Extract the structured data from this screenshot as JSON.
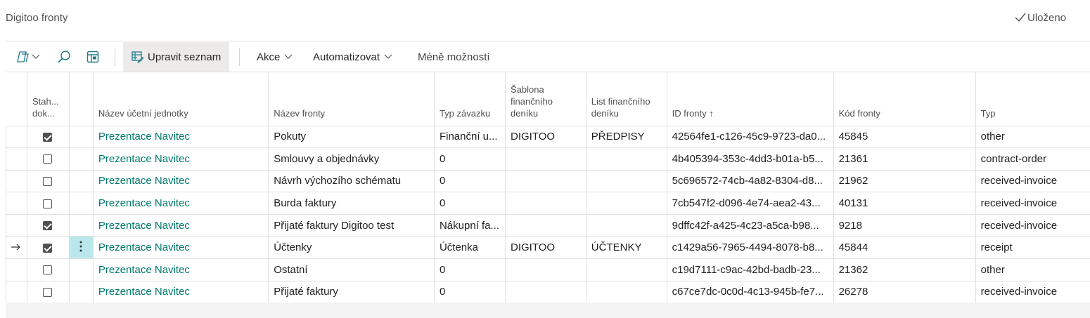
{
  "header": {
    "title": "Digitoo fronty",
    "saved_label": "Uloženo"
  },
  "toolbar": {
    "edit_list_label": "Upravit seznam",
    "actions_label": "Akce",
    "automate_label": "Automatizovat",
    "fewer_options_label": "Méně možností"
  },
  "table": {
    "columns": [
      "Stah... dok...",
      "Název účetní jednotky",
      "Název fronty",
      "Typ závazku",
      "Šablona finančního deníku",
      "List finančního deníku",
      "ID fronty ↑",
      "Kód fronty",
      "Typ"
    ],
    "rows": [
      {
        "checked": true,
        "company": "Prezentace Navitec",
        "name": "Pokuty",
        "liability": "Finanční u...",
        "template": "DIGITOO",
        "batch": "PŘEDPISY",
        "id": "42564fe1-c126-45c9-9723-da0...",
        "code": "45845",
        "type": "other"
      },
      {
        "checked": false,
        "company": "Prezentace Navitec",
        "name": "Smlouvy a objednávky",
        "liability": "0",
        "template": "",
        "batch": "",
        "id": "4b405394-353c-4dd3-b01a-b5...",
        "code": "21361",
        "type": "contract-order"
      },
      {
        "checked": false,
        "company": "Prezentace Navitec",
        "name": "Návrh výchozího schématu",
        "liability": "0",
        "template": "",
        "batch": "",
        "id": "5c696572-74cb-4a82-8304-d8...",
        "code": "21962",
        "type": "received-invoice"
      },
      {
        "checked": false,
        "company": "Prezentace Navitec",
        "name": "Burda faktury",
        "liability": "0",
        "template": "",
        "batch": "",
        "id": "7cb547f2-d096-4e74-aea2-43...",
        "code": "40131",
        "type": "received-invoice"
      },
      {
        "checked": true,
        "company": "Prezentace Navitec",
        "name": "Přijaté faktury Digitoo test",
        "liability": "Nákupní fa...",
        "template": "",
        "batch": "",
        "id": "9dffc42f-a425-4c23-a5ca-b98...",
        "code": "9218",
        "type": "received-invoice"
      },
      {
        "checked": true,
        "company": "Prezentace Navitec",
        "name": "Účtenky",
        "liability": "Účtenka",
        "template": "DIGITOO",
        "batch": "ÚČTENKY",
        "id": "c1429a56-7965-4494-8078-b8...",
        "code": "45844",
        "type": "receipt"
      },
      {
        "checked": false,
        "company": "Prezentace Navitec",
        "name": "Ostatní",
        "liability": "0",
        "template": "",
        "batch": "",
        "id": "c19d7111-c9ac-42bd-badb-23...",
        "code": "21362",
        "type": "other"
      },
      {
        "checked": false,
        "company": "Prezentace Navitec",
        "name": "Přijaté faktury",
        "liability": "0",
        "template": "",
        "batch": "",
        "id": "c67ce7dc-0c0d-4c13-945b-fe7...",
        "code": "26278",
        "type": "received-invoice"
      }
    ],
    "selected_row": 5
  },
  "icons": [
    "filter-icon",
    "search-icon",
    "layout-icon",
    "edit-list-icon",
    "chevron-down-icon",
    "checkmark-icon",
    "row-arrow-icon",
    "more-dots-icon"
  ],
  "colors": {
    "link": "#00796b",
    "selected_cell": "#b9e7ec"
  }
}
